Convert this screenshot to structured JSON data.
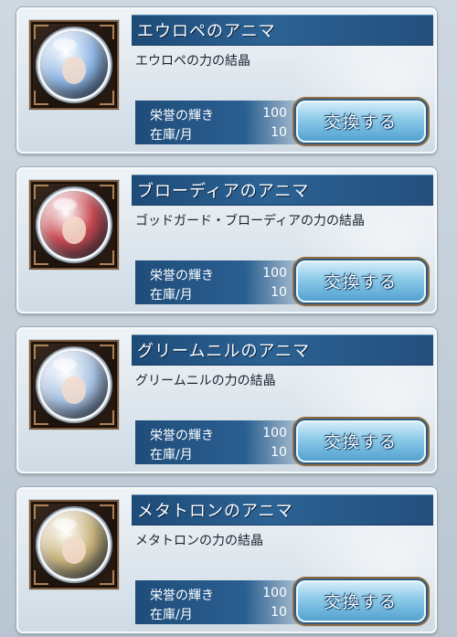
{
  "items": [
    {
      "name": "エウロペのアニマ",
      "description": "エウロペの力の結晶",
      "cost_label": "栄誉の輝き",
      "cost_value": "100",
      "stock_label": "在庫/月",
      "stock_value": "10",
      "button_label": "交換する",
      "orb_color": "#8fb7e6"
    },
    {
      "name": "ブローディアのアニマ",
      "description": "ゴッドガード・ブローディアの力の結晶",
      "cost_label": "栄誉の輝き",
      "cost_value": "100",
      "stock_label": "在庫/月",
      "stock_value": "10",
      "button_label": "交換する",
      "orb_color": "#c8474f"
    },
    {
      "name": "グリームニルのアニマ",
      "description": "グリームニルの力の結晶",
      "cost_label": "栄誉の輝き",
      "cost_value": "100",
      "stock_label": "在庫/月",
      "stock_value": "10",
      "button_label": "交換する",
      "orb_color": "#a9c3e3"
    },
    {
      "name": "メタトロンのアニマ",
      "description": "メタトロンの力の結晶",
      "cost_label": "栄誉の輝き",
      "cost_value": "100",
      "stock_label": "在庫/月",
      "stock_value": "10",
      "button_label": "交換する",
      "orb_color": "#c9b37a"
    }
  ]
}
